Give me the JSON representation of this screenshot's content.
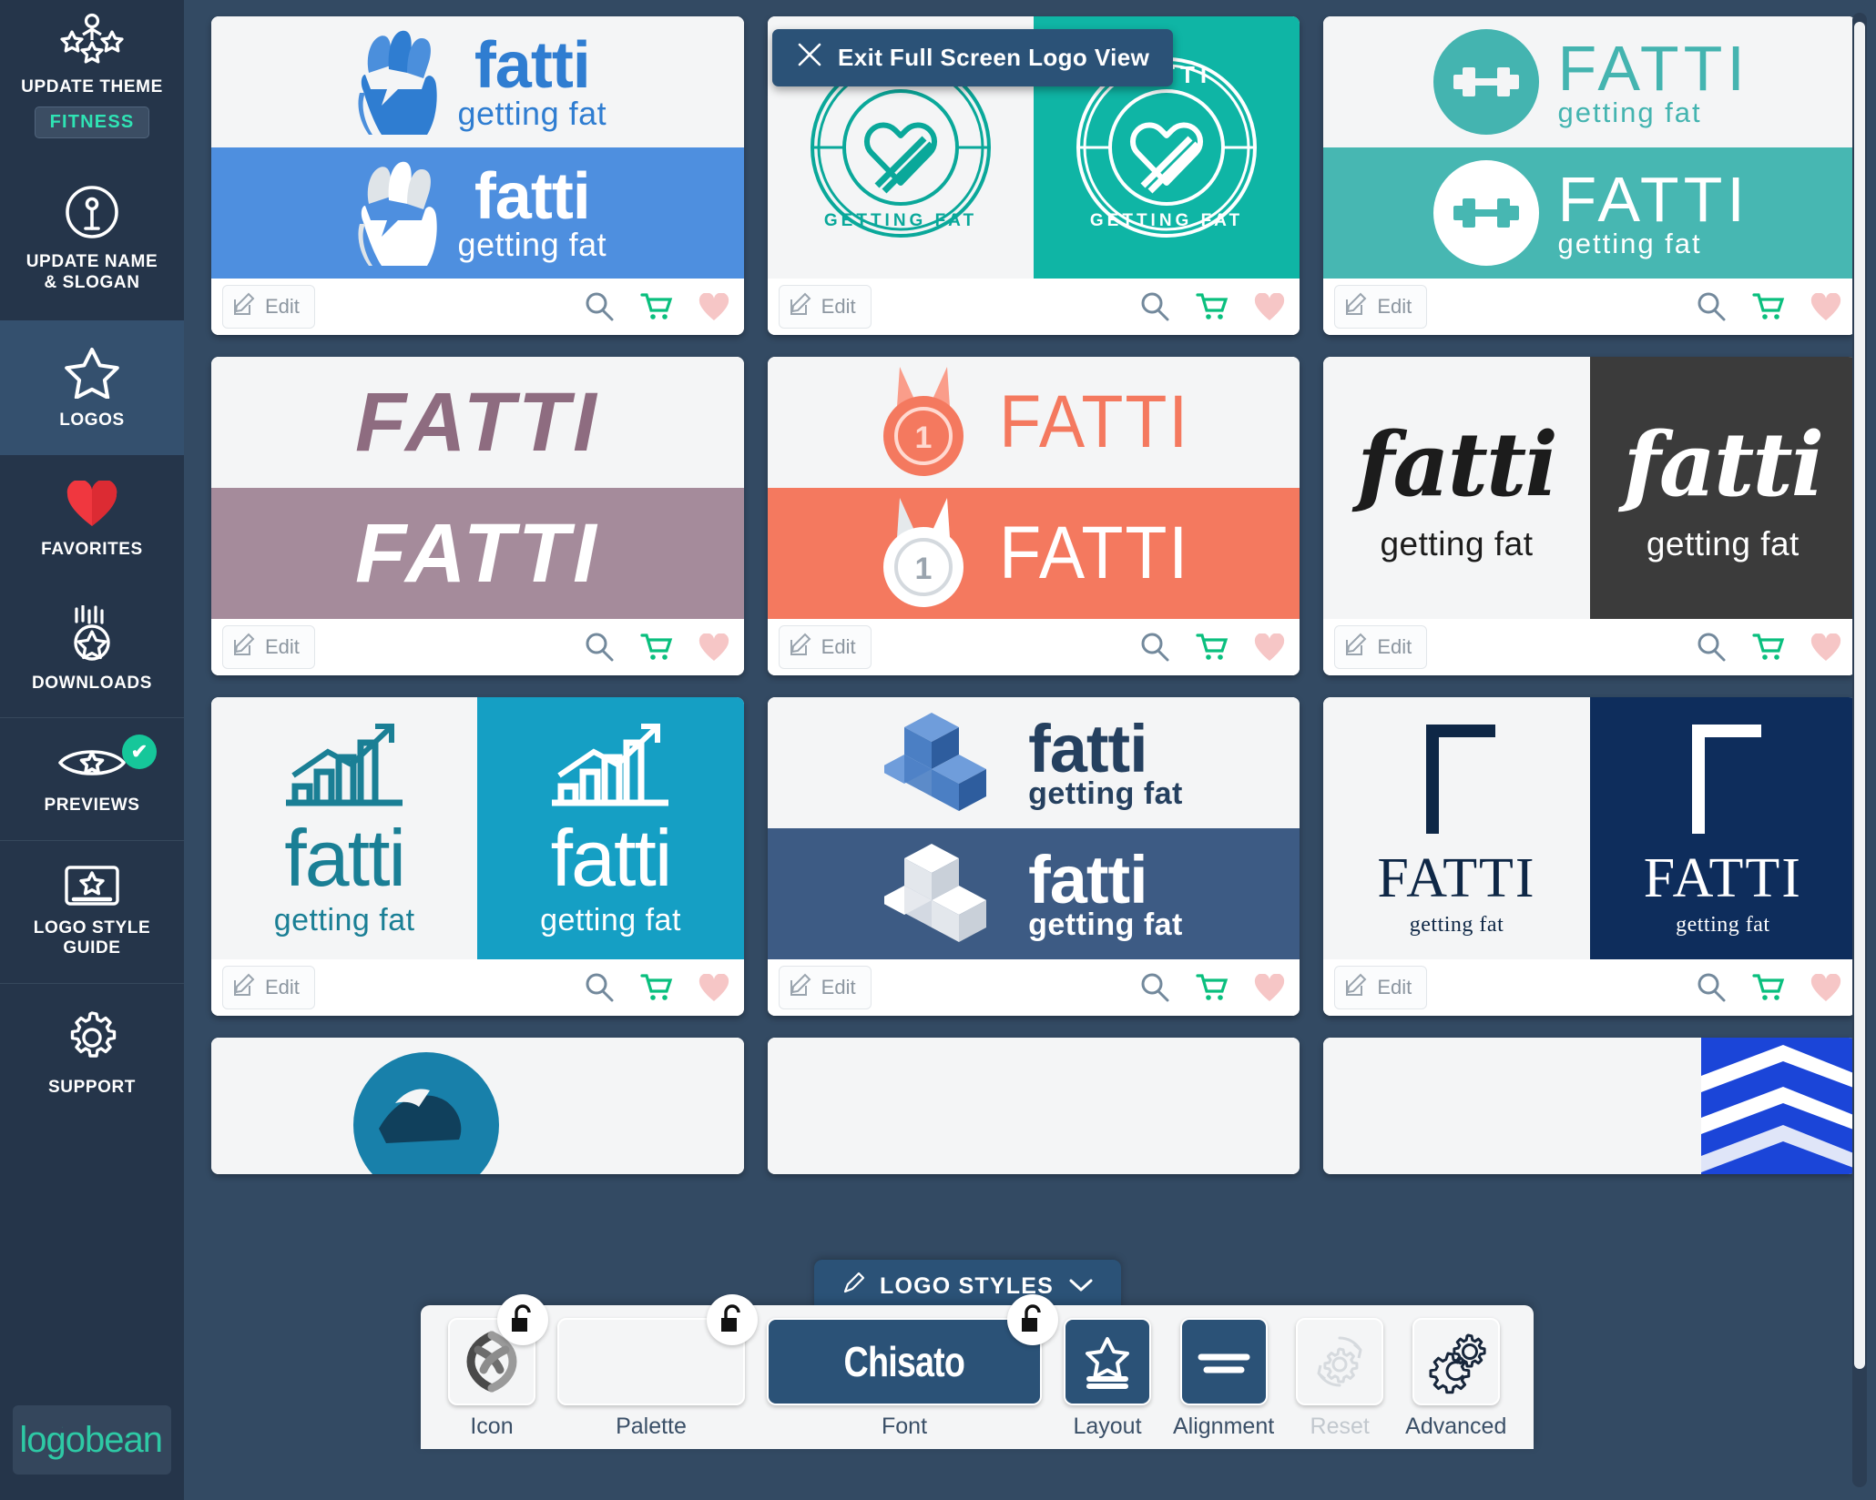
{
  "sidebar": {
    "items": [
      {
        "id": "update-theme",
        "label": "UPDATE THEME",
        "icon": "stars-person-icon",
        "badge": "FITNESS"
      },
      {
        "id": "update-name",
        "label": "UPDATE NAME\n& SLOGAN",
        "icon": "info-person-icon"
      },
      {
        "id": "logos",
        "label": "LOGOS",
        "icon": "star-icon"
      },
      {
        "id": "favorites",
        "label": "FAVORITES",
        "icon": "heart-icon"
      },
      {
        "id": "downloads",
        "label": "DOWNLOADS",
        "icon": "download-star-icon"
      },
      {
        "id": "previews",
        "label": "PREVIEWS",
        "icon": "eye-star-icon",
        "check": "✔"
      },
      {
        "id": "logo-style-guide",
        "label": "LOGO STYLE\nGUIDE",
        "icon": "style-guide-icon"
      },
      {
        "id": "support",
        "label": "SUPPORT",
        "icon": "gear-icon"
      }
    ],
    "brand": "logobean"
  },
  "banner": {
    "label": "Exit Full Screen Logo View",
    "close_icon": "close-x-icon"
  },
  "styles_pill": {
    "label": "LOGO STYLES",
    "pencil_icon": "pencil-icon",
    "chevron_icon": "chevron-down-icon"
  },
  "card_actions": {
    "edit_label": "Edit",
    "edit_icon": "edit-pencil-icon",
    "search_icon": "magnifier-icon",
    "cart_icon": "shopping-cart-icon",
    "heart_icon": "heart-icon"
  },
  "brand_name": "fatti",
  "slogan": "getting fat",
  "toolbar": {
    "items": [
      {
        "id": "icon",
        "label": "Icon",
        "lock": "unlocked-padlock-icon",
        "type": "icon"
      },
      {
        "id": "palette",
        "label": "Palette",
        "lock": "unlocked-padlock-icon",
        "type": "palette",
        "colors": [
          "#3c302b",
          "#6f6a66",
          "#8fa0a1",
          "#b2c3c4",
          "#c9d4d3"
        ]
      },
      {
        "id": "font",
        "label": "Font",
        "lock": "unlocked-padlock-icon",
        "type": "font",
        "value": "Chisato"
      },
      {
        "id": "layout",
        "label": "Layout",
        "type": "button",
        "icon": "layout-star-icon"
      },
      {
        "id": "alignment",
        "label": "Alignment",
        "type": "button",
        "icon": "alignment-lines-icon"
      },
      {
        "id": "reset",
        "label": "Reset",
        "type": "button",
        "icon": "reset-gear-icon",
        "disabled": true
      },
      {
        "id": "advanced",
        "label": "Advanced",
        "type": "button",
        "icon": "advanced-gears-icon"
      }
    ]
  },
  "logos": [
    {
      "id": "fist-blue",
      "style": "icon-left",
      "name": "fatti",
      "slogan": "getting fat",
      "icon": "raised-fist-icon",
      "fg": "#2f7dd1",
      "bg_top": "#f4f5f6",
      "bg_bottom": "#4e8fdf",
      "case": "lower"
    },
    {
      "id": "badge-teal",
      "style": "badge",
      "name": "FATTI",
      "slogan": "GETTING FAT",
      "icon": "heart-dumbbell-badge-icon",
      "fg": "#0aa89a",
      "bg_top": "#f4f5f6",
      "bg_bottom": "#0fb5a5",
      "case": "upper"
    },
    {
      "id": "dumbbell-teal",
      "style": "icon-left",
      "name": "FATTI",
      "slogan": "getting fat",
      "icon": "dumbbell-circle-icon",
      "fg": "#44b4b0",
      "bg_top": "#f4f5f6",
      "bg_bottom": "#47b7b2",
      "case": "upper"
    },
    {
      "id": "brush-mauve",
      "style": "text-only",
      "name": "FATTI",
      "slogan": "",
      "icon": "none",
      "fg": "#8e6c80",
      "bg_top": "#f4f5f6",
      "bg_bottom": "#a58b9b",
      "case": "upper"
    },
    {
      "id": "medal-coral",
      "style": "icon-left",
      "name": "FATTI",
      "slogan": "",
      "icon": "medal-icon",
      "fg": "#f4795f",
      "bg_top": "#f4f5f6",
      "bg_bottom": "#f4795f",
      "case": "upper"
    },
    {
      "id": "script-dark",
      "style": "split",
      "name": "fatti",
      "slogan": "getting fat",
      "icon": "none",
      "fg": "#1c1c1c",
      "bg_top": "#f4f5f6",
      "bg_bottom": "#3b3b3b",
      "case": "script"
    },
    {
      "id": "chart-teal",
      "style": "split-icon",
      "name": "fatti",
      "slogan": "getting fat",
      "icon": "bar-chart-arrow-icon",
      "fg": "#1a7f95",
      "bg_top": "#f4f5f6",
      "bg_bottom": "#159fc4",
      "case": "lower"
    },
    {
      "id": "cubes-navy",
      "style": "icon-left",
      "name": "fatti",
      "slogan": "getting fat",
      "icon": "isometric-cubes-icon",
      "fg": "#25405f",
      "bg_top": "#f4f5f6",
      "bg_bottom": "#3d5b84",
      "case": "lower"
    },
    {
      "id": "serif-navy",
      "style": "split",
      "name": "FATTI",
      "slogan": "getting fat",
      "icon": "corner-bracket-icon",
      "fg": "#0e2746",
      "bg_top": "#f4f5f6",
      "bg_bottom": "#0e2d5c",
      "case": "serif"
    },
    {
      "id": "swimmer-blue",
      "style": "partial",
      "name": "",
      "slogan": "",
      "icon": "swimmer-circle-icon",
      "fg": "#1880aa",
      "bg_top": "#f4f5f6",
      "bg_bottom": "#f4f5f6",
      "case": "lower"
    },
    {
      "id": "partial-mid",
      "style": "partial",
      "name": "",
      "slogan": "",
      "icon": "none",
      "fg": "#2b5277",
      "bg_top": "#f4f5f6",
      "bg_bottom": "#f4f5f6",
      "case": "lower"
    },
    {
      "id": "stripes-blue",
      "style": "partial",
      "name": "",
      "slogan": "",
      "icon": "chevron-stripes-icon",
      "fg": "#1b45d8",
      "bg_top": "#1b45d8",
      "bg_bottom": "#1b45d8",
      "case": "lower"
    }
  ],
  "colors": {
    "app_bg": "#334a63",
    "sidebar_bg": "#25354a",
    "accent_teal": "#2fe3b4",
    "banner_navy": "#2b5277",
    "cart_green": "#0abf7e",
    "heart_pink": "#f6c6c6",
    "search_gray": "#73899c"
  }
}
